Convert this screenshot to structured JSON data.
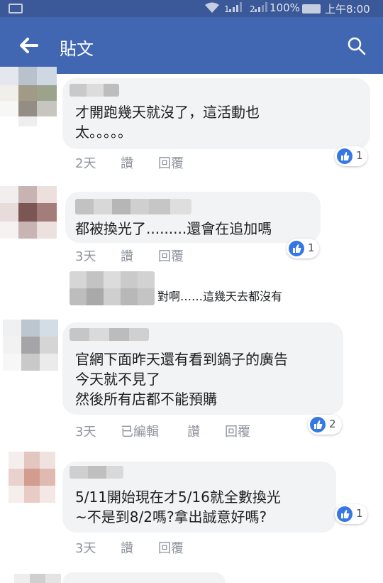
{
  "status_bar": {
    "battery_percent": "100%",
    "time": "上午8:00",
    "signal_1": "1",
    "signal_2": "2"
  },
  "app_bar": {
    "title": "貼文"
  },
  "comments": [
    {
      "text": "才開跑幾天就沒了，這活動也\n太。。。。。",
      "time": "2天",
      "like_label": "讚",
      "reply_label": "回覆",
      "reaction_count": "1"
    },
    {
      "text": "都被換光了.........還會在追加嗎",
      "time": "3天",
      "like_label": "讚",
      "reply_label": "回覆",
      "reaction_count": "1"
    },
    {
      "text": "官網下面昨天還有看到鍋子的廣告\n今天就不見了\n然後所有店都不能預購",
      "time": "3天",
      "edited_label": "已編輯",
      "like_label": "讚",
      "reply_label": "回覆",
      "reaction_count": "2"
    },
    {
      "text": "5/11開始現在才5/16就全數換光\n~不是到8/2嗎?拿出誠意好嗎?",
      "time": "3天",
      "like_label": "讚",
      "reply_label": "回覆",
      "reaction_count": "1"
    }
  ],
  "reply_preview": {
    "text": "對啊……這幾天去都沒有"
  },
  "colors": {
    "status_bar": "#3b5998",
    "app_bar": "#4267b2",
    "bubble": "#f2f3f5",
    "like_blue": "#3578e5"
  }
}
